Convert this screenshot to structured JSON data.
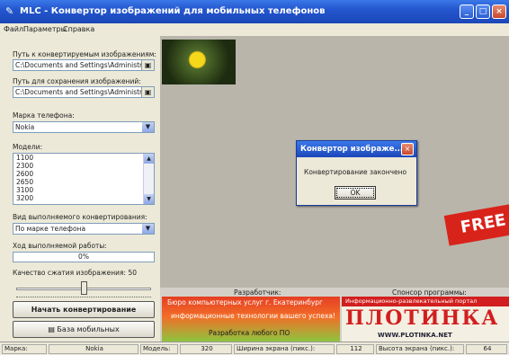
{
  "window": {
    "title": "MLC - Конвертор изображений для мобильных телефонов",
    "minimize_glyph": "_",
    "maximize_glyph": "□",
    "close_glyph": "×"
  },
  "menu": [
    "Файл",
    "Параметры",
    "Справка"
  ],
  "left_panel": {
    "source_label": "Путь к конвертируемым изображениям:",
    "source_value": "C:\\Documents and Settings\\Administr",
    "dest_label": "Путь для сохранения изображений:",
    "dest_value": "C:\\Documents and Settings\\Administr",
    "brand_label": "Марка телефона:",
    "brand_value": "Nokia",
    "models_label": "Модели:",
    "models": [
      "1100",
      "2300",
      "2600",
      "2650",
      "3100",
      "3200"
    ],
    "conversion_type_label": "Вид выполняемого конвертирования:",
    "conversion_type_value": "По марке телефона",
    "progress_label": "Ход выполняемой работы:",
    "progress_value": "0%",
    "progress_fraction": 0,
    "quality_label": "Качество сжатия изображения: 50",
    "quality_value": 50,
    "convert_button": "Начать конвертирование",
    "database_button": "База мобильных"
  },
  "canvas": {
    "free_banner": "FREE"
  },
  "dialog": {
    "title": "Конвертор изображе...",
    "message": "Конвертирование закончено",
    "ok_button": "OK"
  },
  "developer": {
    "label": "Разработчик:",
    "line1": "Бюро компьютерных услуг г. Екатеринбург",
    "line2": "информационные технологии вашего успеха!",
    "line3": "Разработка любого ПО"
  },
  "sponsor": {
    "label": "Спонсор программы:",
    "top": "Информационно-развлекательный портал",
    "logo": "ПЛОТИНКА",
    "url": "WWW.PLOTINKA.NET"
  },
  "status": {
    "brand_label": "Марка:",
    "brand_value": "Nokia",
    "model_label": "Модель:",
    "model_value": "320",
    "width_label": "Ширина экрана (пикс.):",
    "width_value": "112",
    "height_label": "Высота экрана (пикс.):",
    "height_value": "64"
  },
  "colors": {
    "titlebar": "#2457cf",
    "free_banner": "#d8231b",
    "sponsor_red": "#d21e1e"
  },
  "icons": {
    "app": "app-logo-icon",
    "browse": "folder-browse-icon",
    "database": "phone-database-icon",
    "dropdown": "chevron-down-icon"
  }
}
